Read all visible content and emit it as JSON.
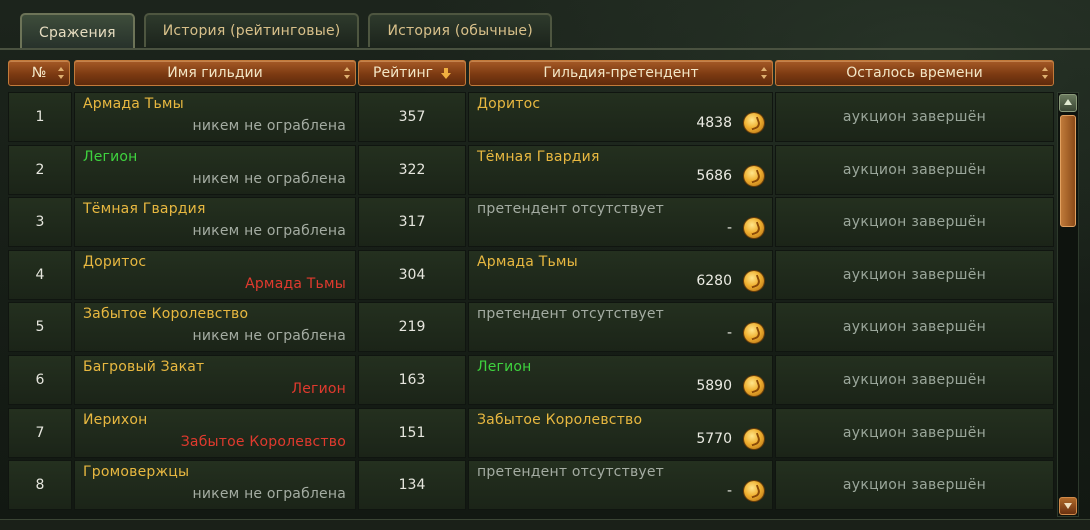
{
  "tabs": [
    {
      "label": "Сражения",
      "active": true
    },
    {
      "label": "История (рейтинговые)",
      "active": false
    },
    {
      "label": "История (обычные)",
      "active": false
    }
  ],
  "columns": {
    "num": "№",
    "guild": "Имя гильдии",
    "rating": "Рейтинг",
    "pretender": "Гильдия-претендент",
    "time": "Осталось времени"
  },
  "rows": [
    {
      "num": "1",
      "guild": "Армада Тьмы",
      "guild_color": "yellow",
      "robbed": "никем не ограблена",
      "robbed_color": "gray",
      "rating": "357",
      "pretender": "Доритос",
      "pretender_color": "yellow",
      "bid": "4838",
      "time": "аукцион завершён"
    },
    {
      "num": "2",
      "guild": "Легион",
      "guild_color": "green",
      "robbed": "никем не ограблена",
      "robbed_color": "gray",
      "rating": "322",
      "pretender": "Тёмная Гвардия",
      "pretender_color": "yellow",
      "bid": "5686",
      "time": "аукцион завершён"
    },
    {
      "num": "3",
      "guild": "Тёмная Гвардия",
      "guild_color": "yellow",
      "robbed": "никем не ограблена",
      "robbed_color": "gray",
      "rating": "317",
      "pretender": "претендент отсутствует",
      "pretender_color": "none",
      "bid": "-",
      "time": "аукцион завершён"
    },
    {
      "num": "4",
      "guild": "Доритос",
      "guild_color": "yellow",
      "robbed": "Армада Тьмы",
      "robbed_color": "red",
      "rating": "304",
      "pretender": "Армада Тьмы",
      "pretender_color": "yellow",
      "bid": "6280",
      "time": "аукцион завершён"
    },
    {
      "num": "5",
      "guild": "Забытое Королевство",
      "guild_color": "yellow",
      "robbed": "никем не ограблена",
      "robbed_color": "gray",
      "rating": "219",
      "pretender": "претендент отсутствует",
      "pretender_color": "none",
      "bid": "-",
      "time": "аукцион завершён"
    },
    {
      "num": "6",
      "guild": "Багровый Закат",
      "guild_color": "yellow",
      "robbed": "Легион",
      "robbed_color": "red",
      "rating": "163",
      "pretender": "Легион",
      "pretender_color": "green",
      "bid": "5890",
      "time": "аукцион завершён"
    },
    {
      "num": "7",
      "guild": "Иерихон",
      "guild_color": "yellow",
      "robbed": "Забытое Королевство",
      "robbed_color": "red",
      "rating": "151",
      "pretender": "Забытое Королевство",
      "pretender_color": "yellow",
      "bid": "5770",
      "time": "аукцион завершён"
    },
    {
      "num": "8",
      "guild": "Громовержцы",
      "guild_color": "yellow",
      "robbed": "никем не ограблена",
      "robbed_color": "gray",
      "rating": "134",
      "pretender": "претендент отсутствует",
      "pretender_color": "none",
      "bid": "-",
      "time": "аукцион завершён"
    }
  ],
  "colors": {
    "guild_yellow": "#e8b840",
    "guild_green": "#3ed23e",
    "robbed_red": "#e03a2e",
    "muted_text": "#a4aca2",
    "header_orange": "#7c3a12"
  }
}
